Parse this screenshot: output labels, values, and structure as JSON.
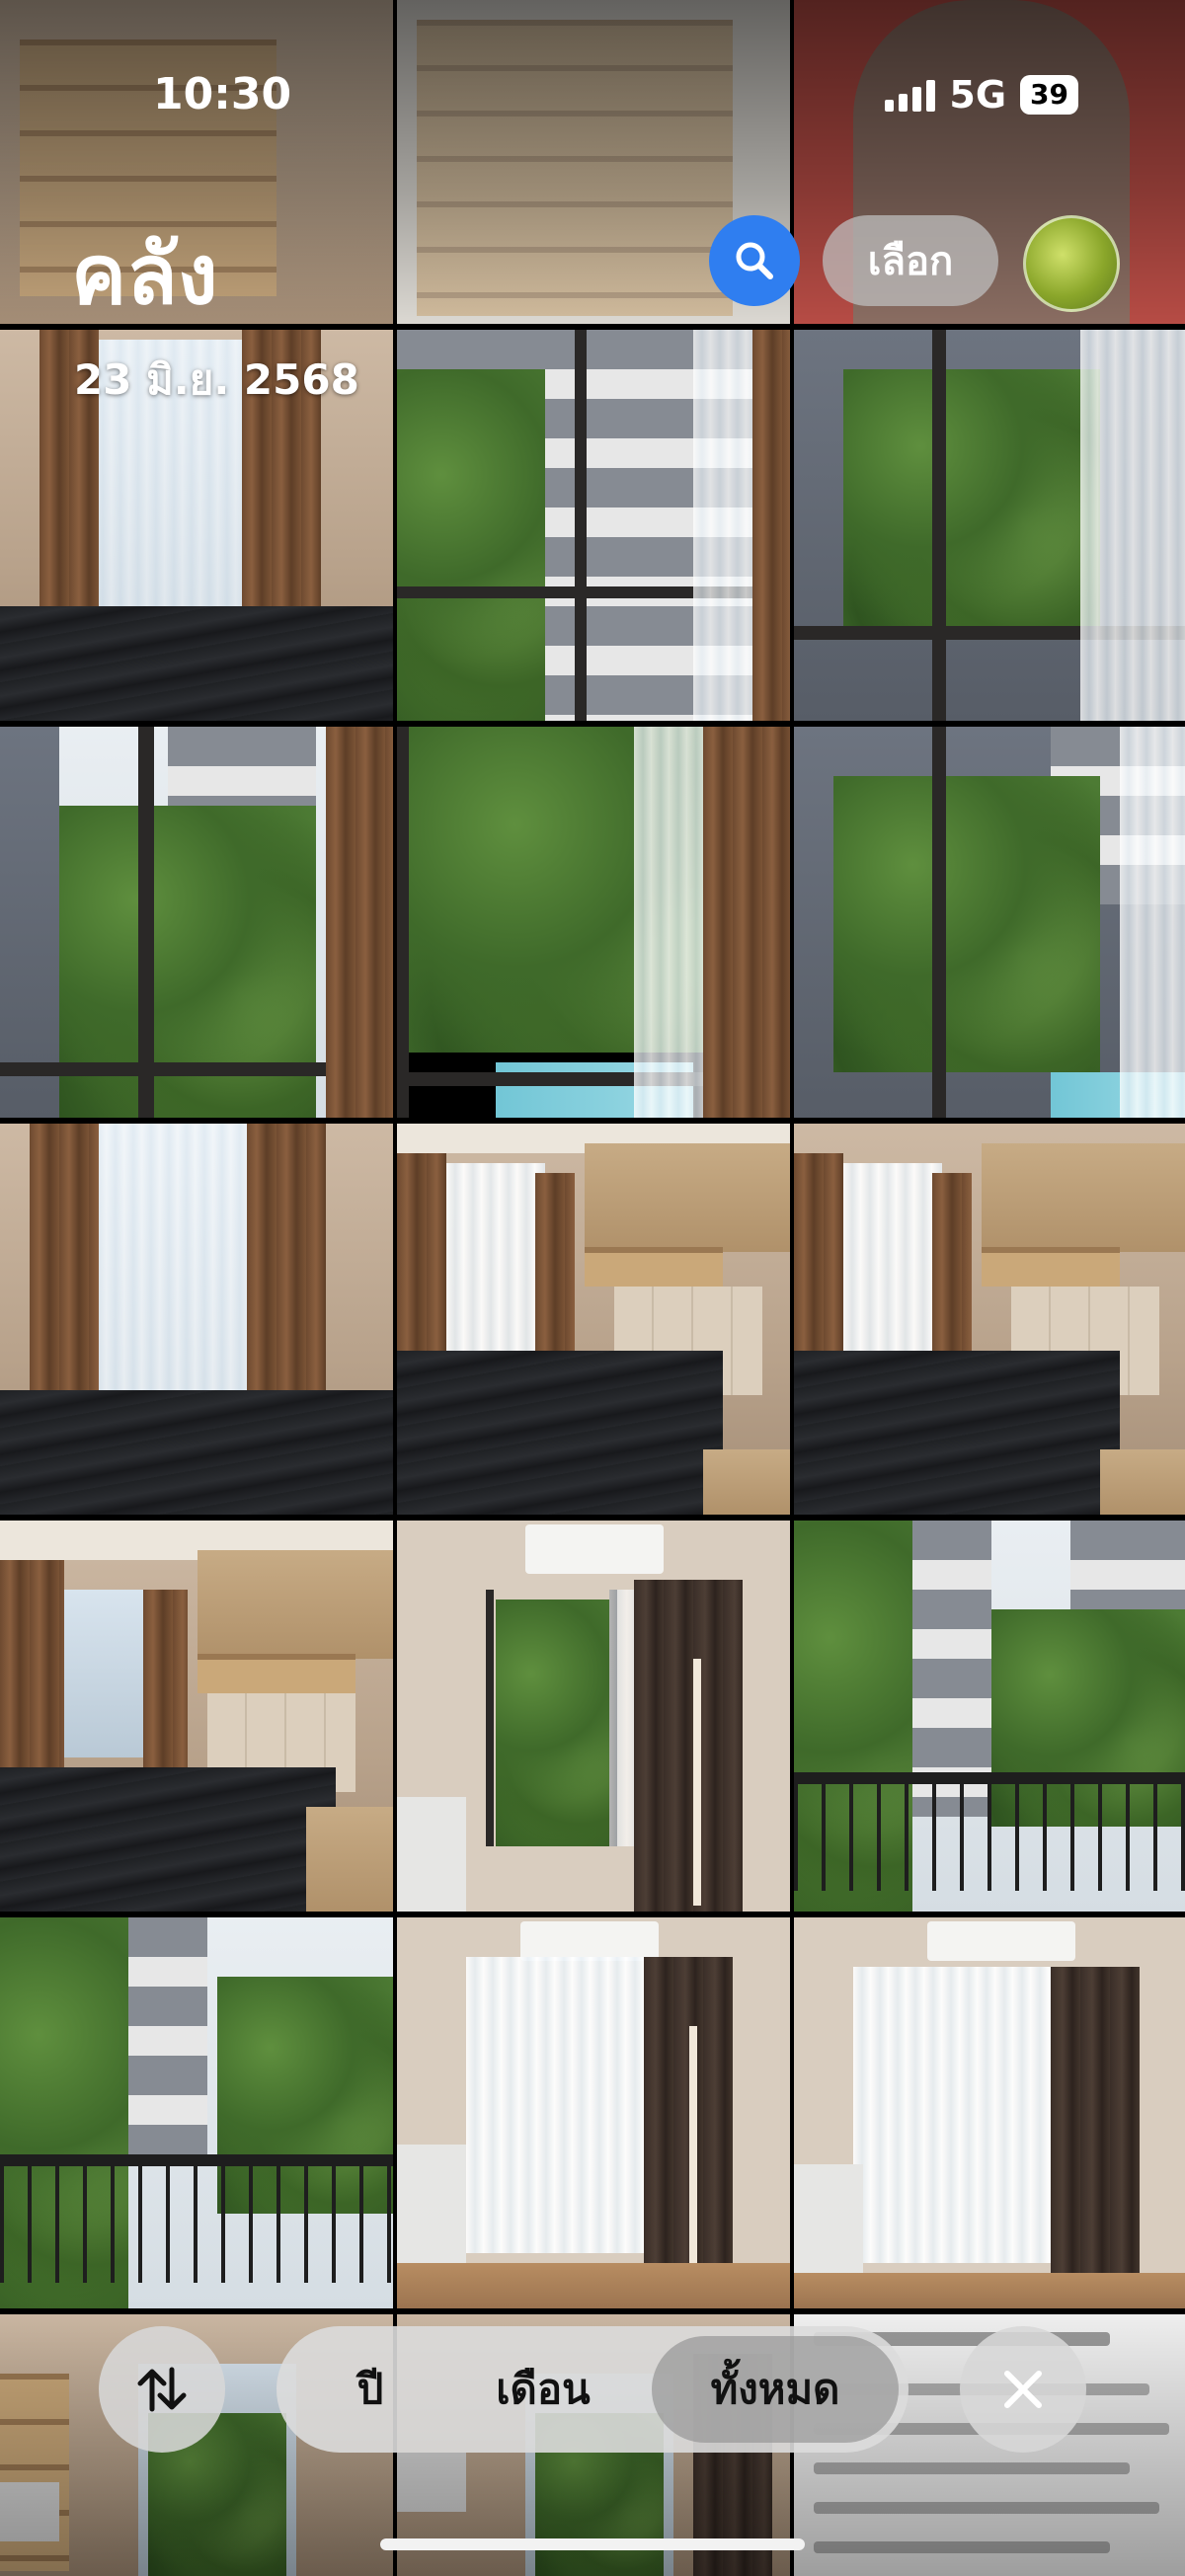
{
  "status_bar": {
    "time": "10:30",
    "network": "5G",
    "battery": "39",
    "signal_bars": 4
  },
  "header": {
    "title": "คลัง",
    "search_icon": "magnifying-glass-icon",
    "select_label": "เลือก",
    "accent_color": "#2f7ef0"
  },
  "grid": {
    "date_label": "23 มิ.ย. 2568",
    "columns": 3,
    "photos": [
      {
        "subject": "bedroom-window"
      },
      {
        "subject": "window-view-building"
      },
      {
        "subject": "window-view-courtyard"
      },
      {
        "subject": "window-view-trees"
      },
      {
        "subject": "window-view-pool"
      },
      {
        "subject": "window-view-parking"
      },
      {
        "subject": "bedroom-window"
      },
      {
        "subject": "bedroom-cabinets"
      },
      {
        "subject": "bedroom-cabinets"
      },
      {
        "subject": "bedroom-wide"
      },
      {
        "subject": "balcony-door-aircon"
      },
      {
        "subject": "balcony-view"
      },
      {
        "subject": "balcony-view-trees"
      },
      {
        "subject": "living-curtain-coatrack"
      },
      {
        "subject": "living-curtain"
      },
      {
        "subject": "kitchen-microwave"
      },
      {
        "subject": "window-view"
      },
      {
        "subject": "shipping-document"
      }
    ]
  },
  "bottom_bar": {
    "sort_icon": "sort-arrows-icon",
    "tabs": [
      {
        "label": "ปี",
        "active": false
      },
      {
        "label": "เดือน",
        "active": false
      },
      {
        "label": "ทั้งหมด",
        "active": true
      }
    ],
    "close_icon": "close-icon"
  }
}
